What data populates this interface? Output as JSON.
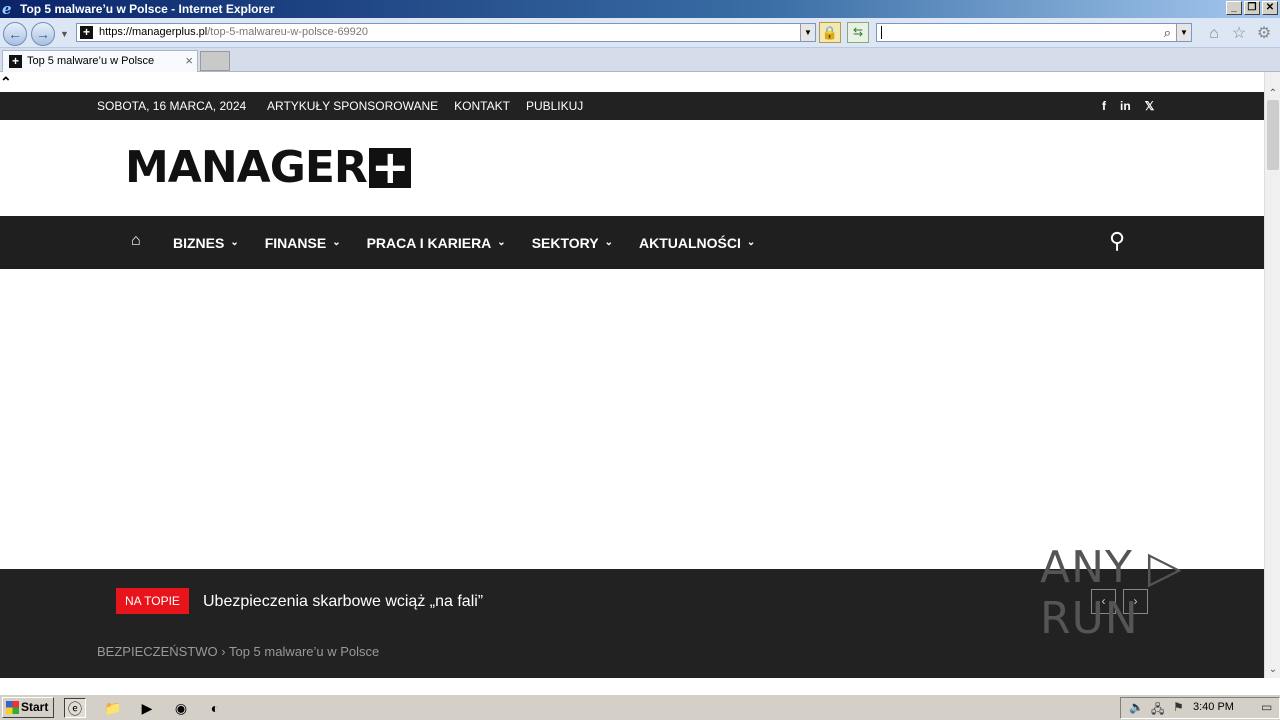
{
  "window": {
    "title": "Top 5 malware’u w Polsce - Internet Explorer",
    "controls": [
      "_",
      "❐",
      "✕"
    ]
  },
  "browser": {
    "back_icon": "back-arrow-icon",
    "forward_icon": "forward-arrow-icon",
    "address_host": "https://managerplus.pl",
    "address_path": "/top-5-malwareu-w-polsce-69920",
    "search_value": "",
    "tab_title": "Top 5 malware’u w Polsce"
  },
  "site": {
    "topbar": {
      "date": "SOBOTA, 16 MARCA, 2024",
      "links": [
        "ARTYKUŁY SPONSOROWANE",
        "KONTAKT",
        "PUBLIKUJ"
      ],
      "social": [
        "f",
        "in",
        "𝕏"
      ]
    },
    "brand": {
      "name": "MANAGER",
      "plus": "+"
    },
    "nav": [
      "BIZNES",
      "FINANSE",
      "PRACA I KARIERA",
      "SEKTORY",
      "AKTUALNOŚCI"
    ],
    "ticker": {
      "badge": "NA TOPIE",
      "headline": "Ubezpieczenia skarbowe wciąż „na fali”",
      "prev": "‹",
      "next": "›"
    },
    "breadcrumb": {
      "category": "BEZPIECZEŃSTWO",
      "separator": "›",
      "current": "Top 5 malware’u w Polsce"
    }
  },
  "watermark": "ANY ▷ RUN",
  "taskbar": {
    "start_label": "Start",
    "clock": "3:40 PM"
  },
  "colors": {
    "accent_red": "#e8141b",
    "dark_bar": "#222222",
    "nav_bar": "#1f1f1f"
  }
}
